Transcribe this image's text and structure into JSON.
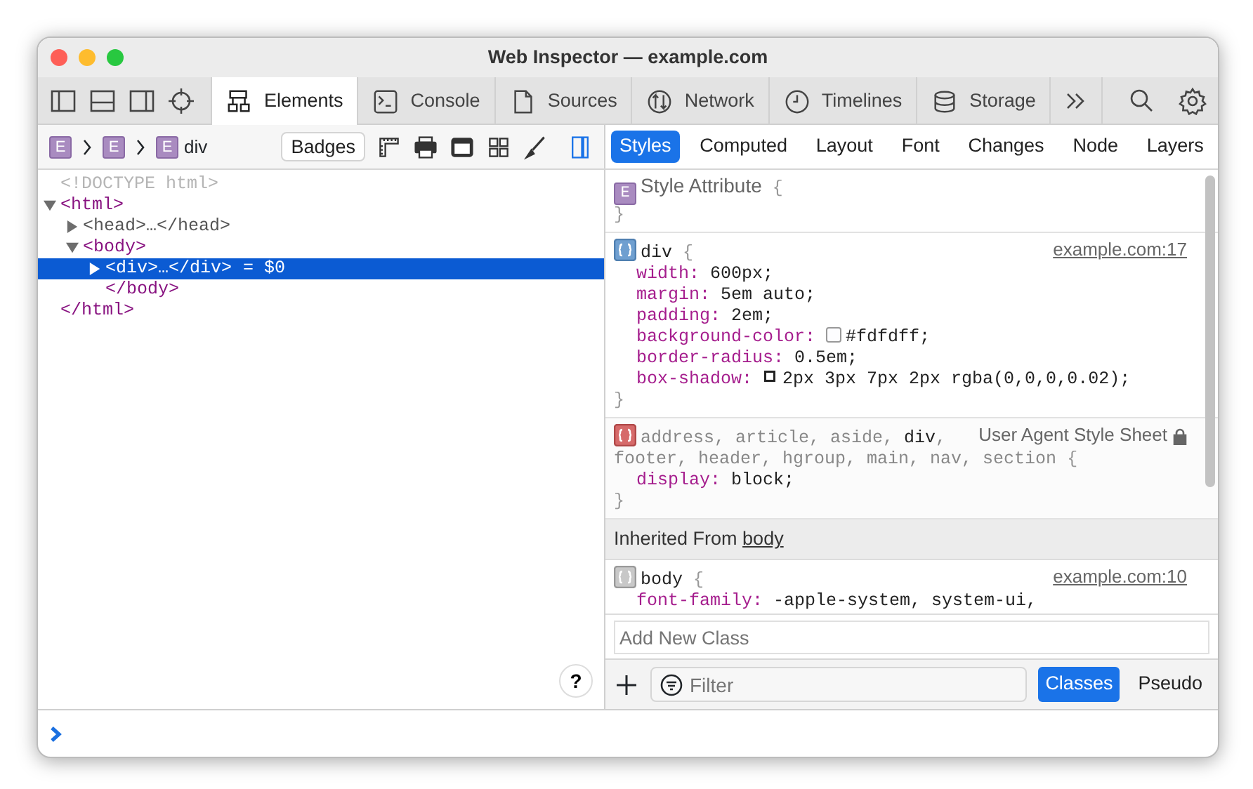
{
  "window": {
    "title": "Web Inspector — example.com"
  },
  "tabs": [
    {
      "label": "Elements",
      "selected": true
    },
    {
      "label": "Console",
      "selected": false
    },
    {
      "label": "Sources",
      "selected": false
    },
    {
      "label": "Network",
      "selected": false
    },
    {
      "label": "Timelines",
      "selected": false
    },
    {
      "label": "Storage",
      "selected": false
    }
  ],
  "breadcrumbs": [
    {
      "badge": "E"
    },
    {
      "badge": "E"
    },
    {
      "badge": "E",
      "label": "div"
    }
  ],
  "badges_button": "Badges",
  "dom_tree": [
    {
      "text": "<!DOCTYPE html>",
      "kind": "doctype",
      "selected": false
    },
    {
      "text": "<html>",
      "kind": "tag",
      "expanded": true,
      "selected": false,
      "children": [
        {
          "text": "<head>…</head>",
          "kind": "collapsed",
          "expanded": false,
          "selected": false
        },
        {
          "text": "<body>",
          "kind": "tag",
          "expanded": true,
          "selected": false,
          "children": [
            {
              "text": "<div>…</div>",
              "kind": "collapsed",
              "expanded": false,
              "selected": true,
              "suffix": "= $0"
            },
            {
              "text": "</body>",
              "kind": "tag",
              "selected": false
            }
          ]
        }
      ]
    },
    {
      "text": "</html>",
      "kind": "tag",
      "selected": false
    }
  ],
  "help_button": "?",
  "sidebar_tabs": [
    {
      "label": "Styles",
      "selected": true
    },
    {
      "label": "Computed",
      "selected": false
    },
    {
      "label": "Layout",
      "selected": false
    },
    {
      "label": "Font",
      "selected": false
    },
    {
      "label": "Changes",
      "selected": false
    },
    {
      "label": "Node",
      "selected": false
    },
    {
      "label": "Layers",
      "selected": false
    }
  ],
  "rules": [
    {
      "kind": "attribute",
      "badge": "E",
      "selector_lines": [
        [
          {
            "text": "Style Attribute",
            "match": true
          }
        ]
      ],
      "open": "{",
      "close": "}"
    },
    {
      "kind": "author",
      "selector_lines": [
        [
          {
            "text": "div",
            "match": true
          }
        ]
      ],
      "open": "{",
      "close": "}",
      "source": "example.com:17",
      "properties": [
        {
          "kind": "plain",
          "name": "width:",
          "value": "600px;"
        },
        {
          "kind": "plain",
          "name": "margin:",
          "value": "5em auto;"
        },
        {
          "kind": "plain",
          "name": "padding:",
          "value": "2em;"
        },
        {
          "kind": "color",
          "name": "background-color:",
          "value": "#fdfdff;"
        },
        {
          "kind": "plain",
          "name": "border-radius:",
          "value": "0.5em;"
        },
        {
          "kind": "shadow",
          "name": "box-shadow:",
          "value": "2px 3px 7px 2px rgba(0,0,0,0.02);"
        }
      ]
    },
    {
      "kind": "user-agent",
      "selector_lines": [
        [
          {
            "text": "address, article, aside, ",
            "match": false
          },
          {
            "text": "div",
            "match": true
          },
          {
            "text": ",",
            "match": false
          }
        ],
        [
          {
            "text": "footer, header, hgroup, main, nav, section",
            "match": false
          }
        ]
      ],
      "open": "{",
      "close": "}",
      "source": "User Agent Style Sheet",
      "properties": [
        {
          "kind": "plain",
          "name": "display:",
          "value": "block;"
        }
      ]
    },
    {
      "kind": "inherited-header",
      "text": "Inherited From ",
      "link": "body"
    },
    {
      "kind": "inherited",
      "selector_lines": [
        [
          {
            "text": "body",
            "match": true
          }
        ]
      ],
      "open": "{",
      "source": "example.com:10",
      "properties": [
        {
          "kind": "plain",
          "name": "font-family:",
          "value": "-apple-system, system-ui,"
        }
      ]
    }
  ],
  "add_class": {
    "placeholder": "Add New Class"
  },
  "filter": {
    "placeholder": "Filter"
  },
  "filter_buttons": [
    {
      "label": "Classes",
      "selected": true
    },
    {
      "label": "Pseudo",
      "selected": false
    }
  ]
}
